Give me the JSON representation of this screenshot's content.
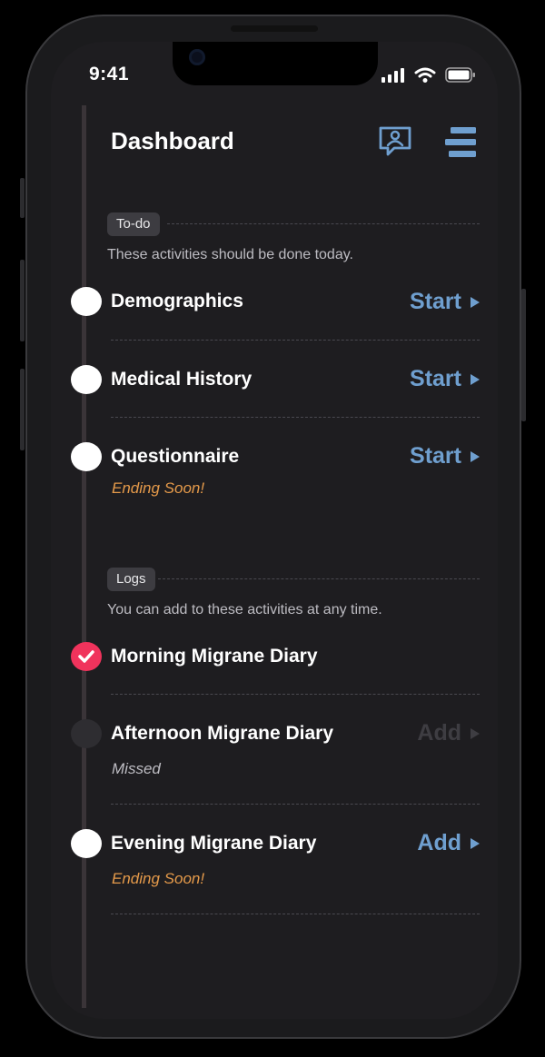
{
  "status_bar": {
    "time": "9:41"
  },
  "header": {
    "title": "Dashboard"
  },
  "todo": {
    "tag": "To-do",
    "description": "These activities should be done today.",
    "items": [
      {
        "title": "Demographics",
        "action": "Start"
      },
      {
        "title": "Medical History",
        "action": "Start"
      },
      {
        "title": "Questionnaire",
        "action": "Start",
        "note": "Ending Soon!"
      }
    ]
  },
  "logs": {
    "tag": "Logs",
    "description": "You can add to these activities at any time.",
    "items": [
      {
        "title": "Morning Migrane Diary",
        "state": "completed"
      },
      {
        "title": "Afternoon Migrane Diary",
        "action": "Add",
        "note": "Missed",
        "state": "missed"
      },
      {
        "title": "Evening Migrane Diary",
        "action": "Add",
        "note": "Ending Soon!"
      }
    ]
  },
  "colors": {
    "accent": "#6f9fcf",
    "warning": "#e59a4a",
    "done": "#f0335c",
    "background": "#1e1d20"
  },
  "icons": [
    "chat-user-icon",
    "menu-icon",
    "signal-icon",
    "wifi-icon",
    "battery-icon",
    "check-icon",
    "play-triangle-icon"
  ]
}
